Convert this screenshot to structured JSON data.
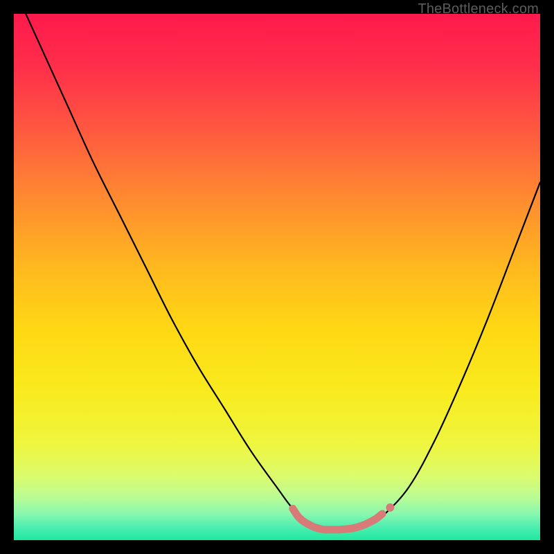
{
  "watermark": "TheBottleneck.com",
  "chart_data": {
    "type": "line",
    "title": "",
    "xlabel": "",
    "ylabel": "",
    "xlim": [
      0,
      100
    ],
    "ylim": [
      0,
      100
    ],
    "series": [
      {
        "name": "bottleneck-curve",
        "x": [
          0,
          5,
          10,
          15,
          20,
          25,
          30,
          35,
          40,
          45,
          50,
          53,
          56,
          59,
          62,
          65,
          68,
          70,
          75,
          80,
          85,
          90,
          95,
          100
        ],
        "y": [
          105,
          94,
          83,
          72,
          62,
          52,
          42,
          33,
          25,
          17,
          10,
          6,
          3.5,
          2.2,
          2,
          2.2,
          3,
          4.5,
          10,
          19,
          30,
          42,
          55,
          68
        ]
      },
      {
        "name": "optimal-marker-segment",
        "x": [
          53,
          54,
          55,
          56,
          57,
          58,
          59,
          60,
          61,
          62,
          63,
          64,
          65,
          66,
          67,
          68,
          69,
          70
        ],
        "y": [
          6,
          4.5,
          3.6,
          3,
          2.5,
          2.2,
          2,
          2,
          2,
          2,
          2.1,
          2.2,
          2.4,
          2.7,
          3.1,
          3.6,
          4.2,
          5
        ]
      },
      {
        "name": "optimal-marker-dot",
        "x": [
          71.5
        ],
        "y": [
          6.2
        ]
      }
    ],
    "gradient_stops": [
      {
        "offset": 0.0,
        "color": "#ff1a4d"
      },
      {
        "offset": 0.1,
        "color": "#ff2e4a"
      },
      {
        "offset": 0.22,
        "color": "#ff5840"
      },
      {
        "offset": 0.35,
        "color": "#ff8a30"
      },
      {
        "offset": 0.48,
        "color": "#ffb81f"
      },
      {
        "offset": 0.6,
        "color": "#ffd814"
      },
      {
        "offset": 0.72,
        "color": "#f8eb1e"
      },
      {
        "offset": 0.82,
        "color": "#eef640"
      },
      {
        "offset": 0.88,
        "color": "#dbfb6e"
      },
      {
        "offset": 0.92,
        "color": "#b8fc95"
      },
      {
        "offset": 0.95,
        "color": "#88f7ad"
      },
      {
        "offset": 0.975,
        "color": "#4eeeb0"
      },
      {
        "offset": 1.0,
        "color": "#1fe8a0"
      }
    ],
    "marker_color": "#d87a78"
  }
}
